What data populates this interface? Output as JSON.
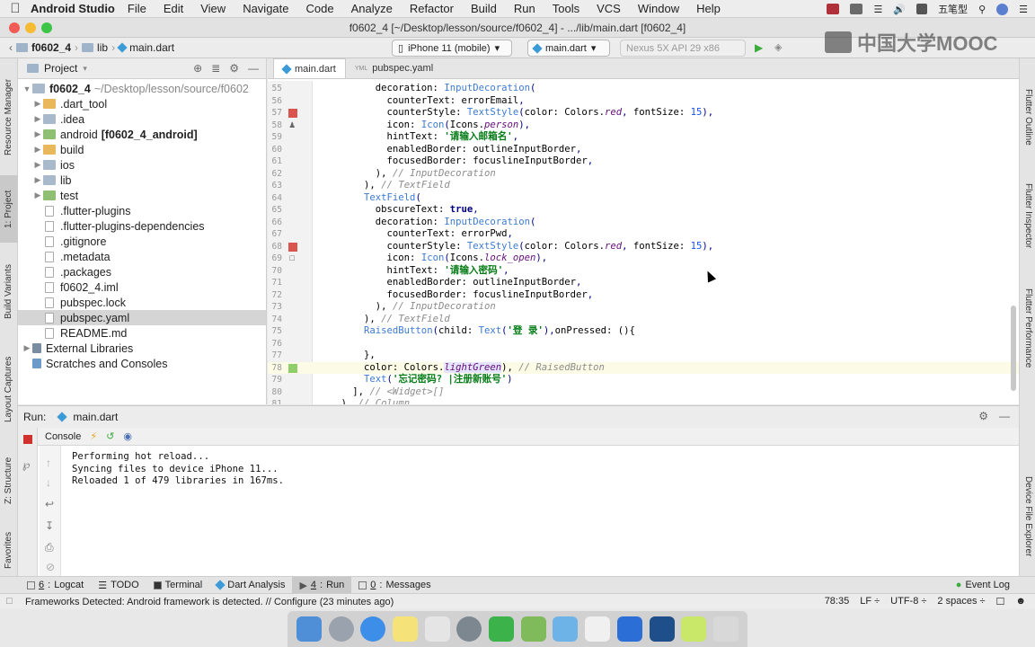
{
  "menubar": {
    "app_name": "Android Studio",
    "menus": [
      "File",
      "Edit",
      "View",
      "Navigate",
      "Code",
      "Analyze",
      "Refactor",
      "Build",
      "Run",
      "Tools",
      "VCS",
      "Window",
      "Help"
    ],
    "input_method": "五笔型"
  },
  "window": {
    "title": "f0602_4 [~/Desktop/lesson/source/f0602_4] - .../lib/main.dart [f0602_4]"
  },
  "navbar": {
    "project": "f0602_4",
    "lib": "lib",
    "file": "main.dart",
    "device": "iPhone 11 (mobile)",
    "run_config": "main.dart",
    "avd": "Nexus 5X API 29 x86"
  },
  "watermark": "中国大学MOOC",
  "left_tool_tabs": [
    "Resource Manager",
    "1: Project",
    "Build Variants",
    "Layout Captures",
    "Z: Structure",
    "Favorites"
  ],
  "right_tool_tabs": [
    "Flutter Outline",
    "Flutter Inspector",
    "Flutter Performance",
    "Device File Explorer"
  ],
  "project_panel": {
    "title": "Project",
    "root": "f0602_4",
    "root_path": "~/Desktop/lesson/source/f0602",
    "items": [
      {
        "label": ".dart_tool"
      },
      {
        "label": ".idea"
      },
      {
        "label": "android",
        "suffix": "[f0602_4_android]"
      },
      {
        "label": "build"
      },
      {
        "label": "ios"
      },
      {
        "label": "lib"
      },
      {
        "label": "test"
      },
      {
        "label": ".flutter-plugins"
      },
      {
        "label": ".flutter-plugins-dependencies"
      },
      {
        "label": ".gitignore"
      },
      {
        "label": ".metadata"
      },
      {
        "label": ".packages"
      },
      {
        "label": "f0602_4.iml"
      },
      {
        "label": "pubspec.lock"
      },
      {
        "label": "pubspec.yaml"
      },
      {
        "label": "README.md"
      },
      {
        "label": "External Libraries"
      },
      {
        "label": "Scratches and Consoles"
      }
    ]
  },
  "editor": {
    "tabs": [
      "main.dart",
      "pubspec.yaml"
    ],
    "line_numbers": [
      "55",
      "56",
      "57",
      "58",
      "59",
      "60",
      "61",
      "62",
      "63",
      "64",
      "65",
      "66",
      "67",
      "68",
      "69",
      "70",
      "71",
      "72",
      "73",
      "74",
      "75",
      "76",
      "77",
      "78",
      "79",
      "80",
      "81"
    ]
  },
  "run_panel": {
    "label": "Run:",
    "tab": "main.dart",
    "console_tab": "Console",
    "console_lines": [
      "Performing hot reload...",
      "Syncing files to device iPhone 11...",
      "Reloaded 1 of 479 libraries in 167ms."
    ]
  },
  "bottom_tabs": [
    {
      "key": "6",
      "label": "Logcat"
    },
    {
      "key": "",
      "label": "TODO"
    },
    {
      "key": "",
      "label": "Terminal"
    },
    {
      "key": "",
      "label": "Dart Analysis"
    },
    {
      "key": "4",
      "label": "Run"
    },
    {
      "key": "0",
      "label": "Messages"
    }
  ],
  "event_log": "Event Log",
  "status": {
    "message": "Frameworks Detected: Android framework is detected. // Configure (23 minutes ago)",
    "position": "78:35",
    "line_sep": "LF ÷",
    "encoding": "UTF-8 ÷",
    "indent": "2 spaces ÷"
  }
}
